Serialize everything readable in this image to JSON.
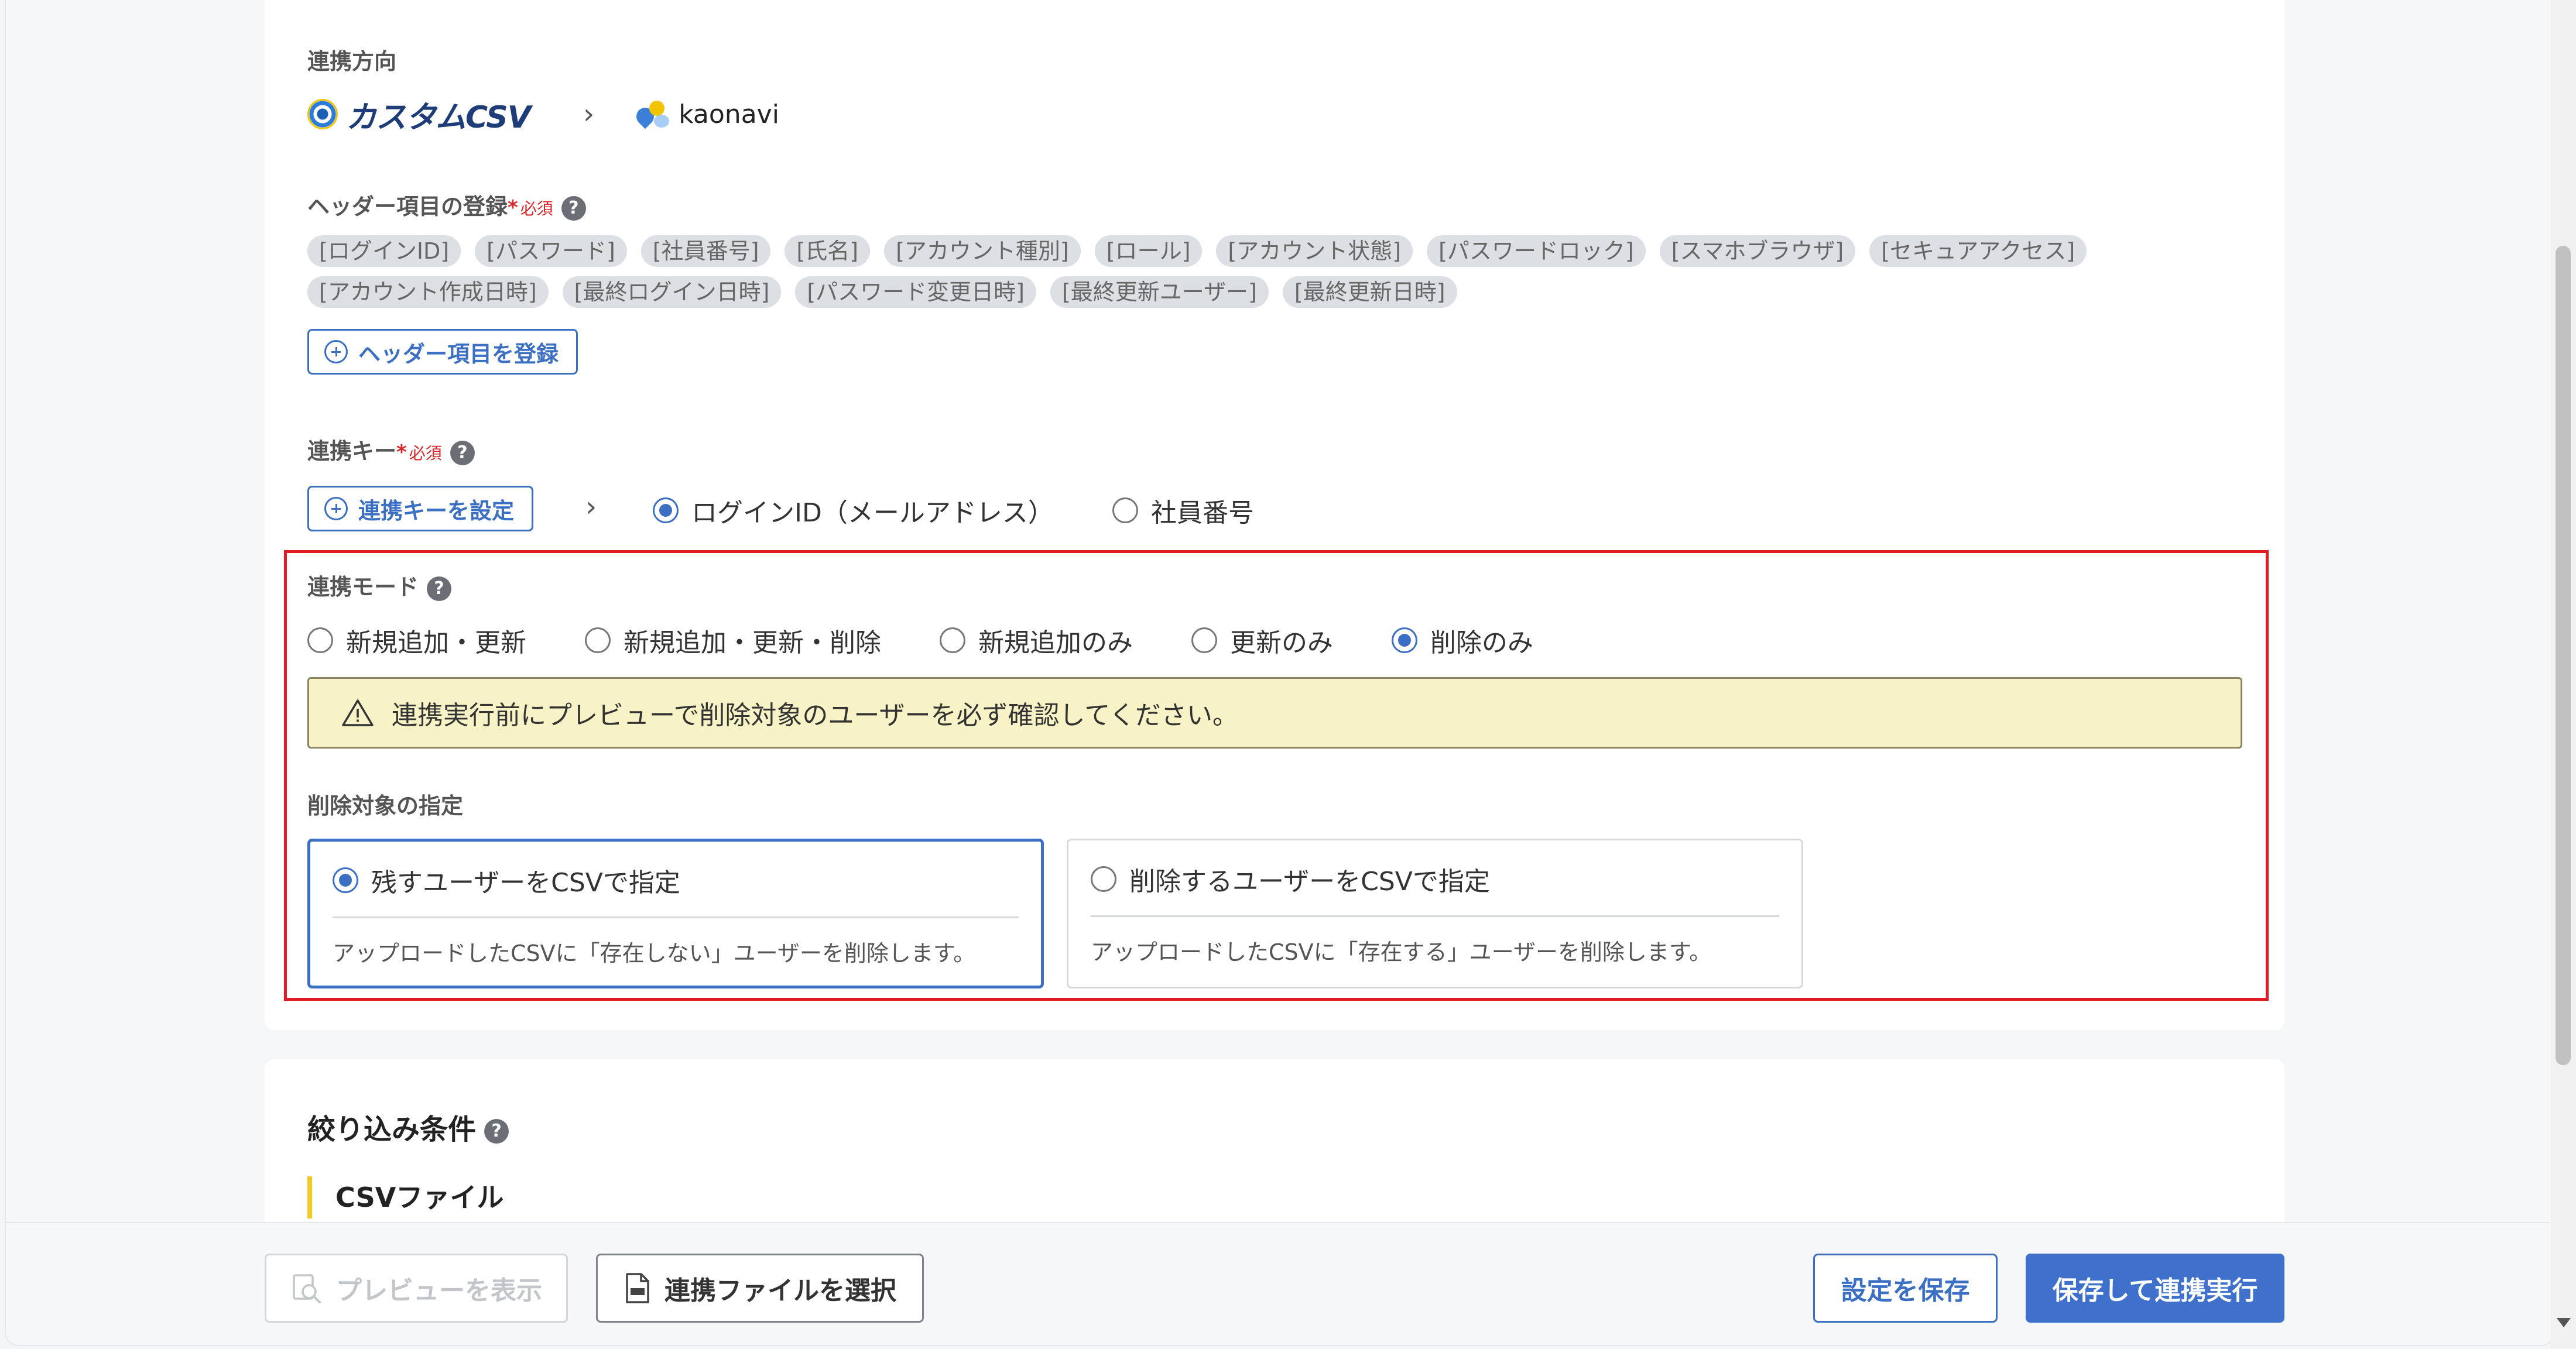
{
  "direction": {
    "label": "連携方向",
    "source": "カスタムCSV",
    "arrow": "›",
    "target": "kaonavi"
  },
  "header_items": {
    "label": "ヘッダー項目の登録",
    "required_mark": "*",
    "required_text": "必須",
    "help": "?",
    "chips": [
      "[ログインID]",
      "[パスワード]",
      "[社員番号]",
      "[氏名]",
      "[アカウント種別]",
      "[ロール]",
      "[アカウント状態]",
      "[パスワードロック]",
      "[スマホブラウザ]",
      "[セキュアアクセス]",
      "[アカウント作成日時]",
      "[最終ログイン日時]",
      "[パスワード変更日時]",
      "[最終更新ユーザー]",
      "[最終更新日時]"
    ],
    "register_button": "ヘッダー項目を登録"
  },
  "link_key": {
    "label": "連携キー",
    "required_mark": "*",
    "required_text": "必須",
    "help": "?",
    "set_button": "連携キーを設定",
    "arrow": "›",
    "options": [
      {
        "label": "ログインID（メールアドレス）",
        "selected": true
      },
      {
        "label": "社員番号",
        "selected": false
      }
    ]
  },
  "link_mode": {
    "label": "連携モード",
    "help": "?",
    "options": [
      {
        "label": "新規追加・更新",
        "selected": false
      },
      {
        "label": "新規追加・更新・削除",
        "selected": false
      },
      {
        "label": "新規追加のみ",
        "selected": false
      },
      {
        "label": "更新のみ",
        "selected": false
      },
      {
        "label": "削除のみ",
        "selected": true
      }
    ],
    "warning": "連携実行前にプレビューで削除対象のユーザーを必ず確認してください。"
  },
  "delete_target": {
    "label": "削除対象の指定",
    "options": [
      {
        "title": "残すユーザーをCSVで指定",
        "desc": "アップロードしたCSVに「存在しない」ユーザーを削除します。",
        "selected": true
      },
      {
        "title": "削除するユーザーをCSVで指定",
        "desc": "アップロードしたCSVに「存在する」ユーザーを削除します。",
        "selected": false
      }
    ]
  },
  "filter": {
    "title": "絞り込み条件",
    "help": "?",
    "subtitle": "CSVファイル"
  },
  "footer": {
    "preview_button": "プレビューを表示",
    "select_file_button": "連携ファイルを選択",
    "save_button": "設定を保存",
    "save_run_button": "保存して連携実行"
  },
  "colors": {
    "accent": "#3b6fc4",
    "highlight_border": "#e21b24",
    "warning_bg": "#f8f3c6",
    "required": "#d9262b"
  }
}
